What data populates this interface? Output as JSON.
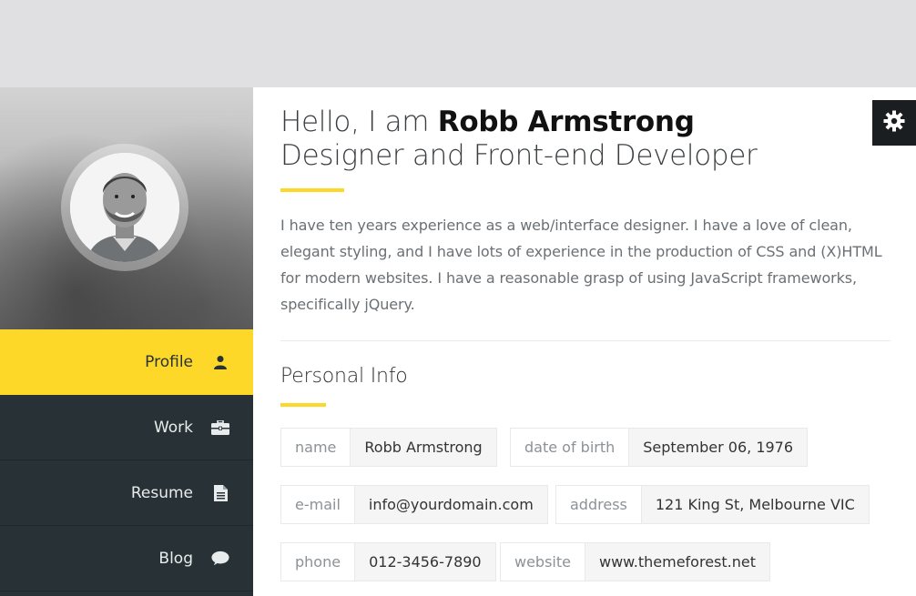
{
  "sidebar": {
    "nav": [
      {
        "label": "Profile",
        "icon": "user-icon",
        "active": true
      },
      {
        "label": "Work",
        "icon": "briefcase-icon",
        "active": false
      },
      {
        "label": "Resume",
        "icon": "document-icon",
        "active": false
      },
      {
        "label": "Blog",
        "icon": "chat-bubble-icon",
        "active": false
      }
    ]
  },
  "header": {
    "greeting": "Hello, I am",
    "name": "Robb Armstrong",
    "role": "Designer and Front-end Developer"
  },
  "intro": "I have ten years experience as a web/interface designer. I have a love of clean, elegant styling, and I have lots of experience in the production of CSS and (X)HTML for modern websites. I have a reasonable grasp of using JavaScript frameworks, specifically jQuery.",
  "personal_info": {
    "title": "Personal Info",
    "fields": [
      {
        "key": "name",
        "value": "Robb Armstrong"
      },
      {
        "key": "date of birth",
        "value": "September 06, 1976"
      },
      {
        "key": "e-mail",
        "value": "info@yourdomain.com"
      },
      {
        "key": "address",
        "value": "121 King St, Melbourne VIC"
      },
      {
        "key": "phone",
        "value": "012-3456-7890"
      },
      {
        "key": "website",
        "value": "www.themeforest.net"
      }
    ]
  },
  "colors": {
    "accent": "#fed828",
    "sidebar": "#283236",
    "settings_button": "#1b1e20"
  }
}
